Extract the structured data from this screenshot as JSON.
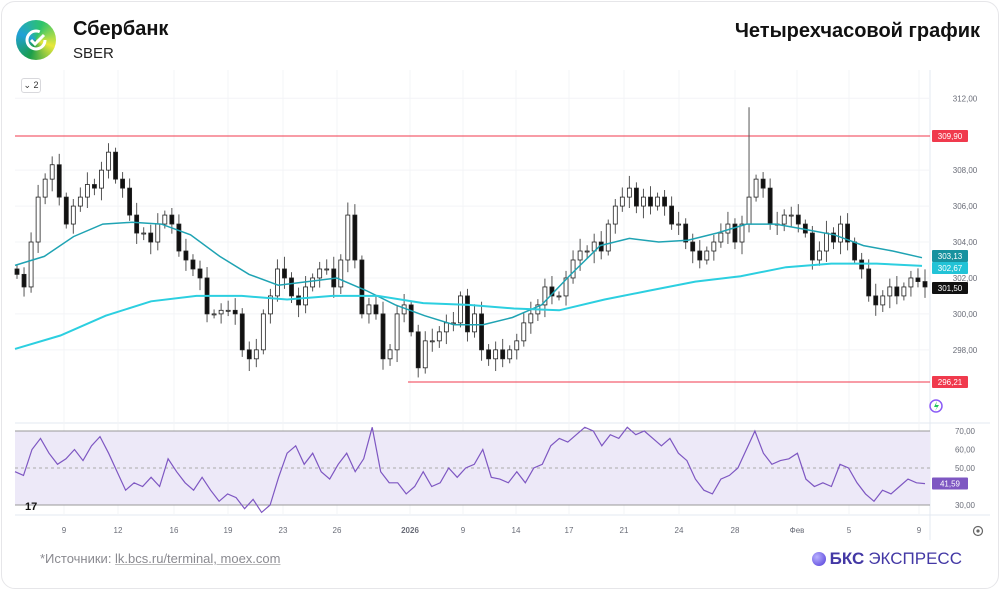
{
  "header": {
    "company": "Сбербанк",
    "ticker": "SBER",
    "chart_title": "Четырехчасовой график",
    "collapse_label": "⌄ 2"
  },
  "footer": {
    "sources_prefix": "*Источники: ",
    "sources": "lk.bcs.ru/terminal, moex.com",
    "brand_bold": "БКС",
    "brand_rest": " ЭКСПРЕСС"
  },
  "colors": {
    "up_body": "#ffffff",
    "down_body": "#111111",
    "ma_fast": "#1fa3b3",
    "ma_slow": "#2ccfe0",
    "level": "#f03a4d",
    "rsi": "#7e57c2",
    "rsi_band": "#ede9f8"
  },
  "chart_data": {
    "type": "candlestick",
    "title": "Четырехчасовой график",
    "ylim": [
      295.5,
      312.5
    ],
    "y_ticks": [
      "312,00",
      "308,00",
      "306,00",
      "304,00",
      "302,00",
      "300,00",
      "298,00"
    ],
    "y_tick_values": [
      312,
      308,
      306,
      304,
      302,
      300,
      298
    ],
    "x_ticks": [
      "9",
      "12",
      "16",
      "19",
      "23",
      "26",
      "2026",
      "9",
      "14",
      "17",
      "21",
      "24",
      "28",
      "Фев",
      "5",
      "9"
    ],
    "closes": [
      302.2,
      301.5,
      304,
      306.5,
      307.5,
      308.3,
      306.5,
      305,
      306,
      306.5,
      307.2,
      307,
      308,
      309,
      307.5,
      307,
      305.5,
      304.5,
      304.5,
      304,
      305,
      305.5,
      305,
      303.5,
      303,
      302.5,
      302,
      300,
      300,
      300.2,
      300.2,
      300,
      298,
      297.5,
      298,
      300,
      301,
      302.5,
      302,
      301,
      300.5,
      301.5,
      302,
      302.5,
      302.5,
      301.5,
      303,
      305.5,
      303,
      300,
      300.5,
      300,
      297.5,
      298,
      300,
      300.5,
      299,
      297,
      298.5,
      298.5,
      299,
      299.5,
      299.5,
      301,
      299,
      300,
      298,
      297.5,
      298,
      297.5,
      298,
      298.5,
      299.5,
      300,
      300.5,
      301.5,
      301,
      301,
      302,
      303,
      303.5,
      303.5,
      304,
      303.5,
      305,
      306,
      306.5,
      307,
      306,
      306.5,
      306,
      306.5,
      306,
      305,
      305,
      304,
      303.5,
      303,
      303.5,
      304,
      304.5,
      305,
      304,
      305,
      306.5,
      307.5,
      307,
      305,
      305,
      305.5,
      305.5,
      305,
      304.5,
      303,
      303.5,
      304.5,
      304,
      305,
      304,
      303,
      302.5,
      301,
      300.5,
      301,
      301.5,
      301,
      301.5,
      302,
      301.8,
      301.5
    ],
    "spike_highs": [
      {
        "index": 104,
        "high": 311.5
      },
      {
        "index": 13,
        "high": 309.5
      },
      {
        "index": 47,
        "high": 306.2
      }
    ],
    "moving_averages": [
      {
        "name": "MA fast",
        "last": "303,13",
        "values": [
          302.7,
          303.2,
          304.3,
          305,
          305.1,
          305,
          304.4,
          303.2,
          302.2,
          301.6,
          301.8,
          302,
          301.3,
          300.5,
          299.9,
          299.4,
          299.4,
          299.8,
          300.5,
          302.2,
          303.8,
          304.2,
          304,
          304.1,
          304.5,
          305,
          305,
          304.7,
          304.4,
          303.8,
          303.5,
          303.13
        ]
      },
      {
        "name": "MA slow",
        "last": "302,67",
        "values": [
          298.05,
          298.8,
          299.9,
          300.7,
          301,
          301,
          300.8,
          301,
          301,
          300.6,
          300.5,
          300.3,
          300.2,
          300.8,
          301.3,
          301.8,
          302.1,
          302.6,
          302.8,
          302.8,
          302.67
        ]
      }
    ],
    "levels": [
      {
        "value": 309.9,
        "label": "309,90"
      },
      {
        "value": 296.21,
        "label": "296,21"
      }
    ],
    "last_price": {
      "value": 301.5,
      "label": "301,50"
    },
    "rsi": {
      "ylim": [
        22,
        75
      ],
      "y_ticks": [
        "70,00",
        "60,00",
        "50,00",
        "30,00"
      ],
      "y_tick_values": [
        70,
        60,
        50,
        30
      ],
      "band": [
        30,
        70
      ],
      "last": "41,59",
      "values": [
        48,
        46,
        60,
        66,
        58,
        52,
        55,
        60,
        54,
        62,
        67,
        58,
        48,
        38,
        42,
        40,
        45,
        40,
        55,
        48,
        42,
        38,
        45,
        38,
        32,
        36,
        34,
        28,
        33,
        26,
        30,
        45,
        58,
        62,
        52,
        58,
        48,
        44,
        52,
        58,
        48,
        55,
        72,
        48,
        42,
        42,
        36,
        40,
        48,
        40,
        42,
        50,
        45,
        50,
        52,
        60,
        45,
        44,
        42,
        48,
        42,
        50,
        52,
        62,
        66,
        64,
        68,
        72,
        70,
        62,
        68,
        66,
        72,
        68,
        70,
        66,
        62,
        66,
        58,
        54,
        44,
        38,
        36,
        44,
        46,
        50,
        60,
        70,
        58,
        52,
        54,
        55,
        58,
        44,
        40,
        42,
        40,
        52,
        50,
        42,
        36,
        32,
        38,
        36,
        40,
        44,
        42,
        41.59
      ]
    }
  }
}
